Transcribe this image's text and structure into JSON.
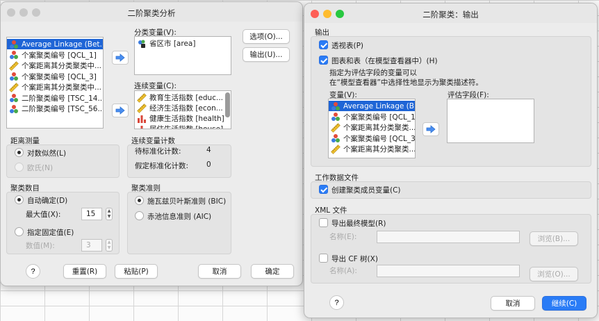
{
  "left_dialog": {
    "title": "二阶聚类分析",
    "variables": [
      {
        "label": "Average Linkage (Bet...",
        "icon": "cluster-icon",
        "selected": true
      },
      {
        "label": "个案聚类编号 [QCL_1]",
        "icon": "cluster-icon"
      },
      {
        "label": "个案距离其分类聚类中...",
        "icon": "ruler-icon"
      },
      {
        "label": "个案聚类编号 [QCL_3]",
        "icon": "cluster-icon"
      },
      {
        "label": "个案距离其分类聚类中...",
        "icon": "ruler-icon"
      },
      {
        "label": "二阶聚类编号 [TSC_14...",
        "icon": "cluster-icon"
      },
      {
        "label": "二阶聚类编号 [TSC_56...",
        "icon": "cluster-icon"
      }
    ],
    "categorical": {
      "label": "分类变量(V):",
      "items": [
        {
          "label": "省区市 [area]",
          "icon": "nominal-icon"
        }
      ]
    },
    "continuous": {
      "label": "连续变量(C):",
      "items": [
        {
          "label": "教育生活指数 [educ...",
          "icon": "ruler-icon"
        },
        {
          "label": "经济生活指数 [econ...",
          "icon": "ruler-icon"
        },
        {
          "label": "健康生活指数 [health]",
          "icon": "barchart-icon"
        },
        {
          "label": "居住生活指数 [house]",
          "icon": "barchart-icon"
        }
      ]
    },
    "buttons": {
      "options": "选项(O)...",
      "output": "输出(U)...",
      "reset": "重置(R)",
      "paste": "粘贴(P)",
      "cancel": "取消",
      "ok": "确定",
      "help": "?"
    },
    "distance": {
      "title": "距离测量",
      "loglik": "对数似然(L)",
      "euclid": "欧氏(N)"
    },
    "count": {
      "title": "连续变量计数",
      "standardized_label": "待标准化计数:",
      "standardized_value": "4",
      "assumed_label": "假定标准化计数:",
      "assumed_value": "0"
    },
    "clusters": {
      "title": "聚类数目",
      "auto": "自动确定(D)",
      "max_label": "最大值(X):",
      "max_value": "15",
      "fixed": "指定固定值(E)",
      "num_label": "数值(M):",
      "num_value": "3"
    },
    "criterion": {
      "title": "聚类准则",
      "bic": "施瓦兹贝叶斯准则 (BIC)",
      "aic": "赤池信息准则 (AIC)"
    }
  },
  "right_dialog": {
    "title": "二阶聚类：输出",
    "output_group": "输出",
    "pivot": "透视表(P)",
    "charts": "图表和表（在模型查看器中）(H)",
    "desc_line1": "指定为评估字段的变量可以",
    "desc_line2": "在“模型查看器”中选择性地显示为聚类描述符。",
    "vars_label": "变量(V):",
    "eval_label": "评估字段(F):",
    "variables": [
      {
        "label": "Average Linkage (B...",
        "icon": "cluster-icon",
        "selected": true
      },
      {
        "label": "个案聚类编号 [QCL_1]",
        "icon": "cluster-icon"
      },
      {
        "label": "个案距离其分类聚类...",
        "icon": "ruler-icon"
      },
      {
        "label": "个案聚类编号 [QCL_3]",
        "icon": "cluster-icon"
      },
      {
        "label": "个案距离其分类聚类...",
        "icon": "ruler-icon"
      }
    ],
    "workdata_group": "工作数据文件",
    "create_var": "创建聚类成员变量(C)",
    "xml_group": "XML 文件",
    "export_final": "导出最终模型(R)",
    "name_e": "名称(E):",
    "browse_b": "浏览(B)...",
    "export_cf": "导出 CF 树(X)",
    "name_a": "名称(A):",
    "browse_o": "浏览(O)...",
    "help": "?",
    "cancel": "取消",
    "continue": "继续(C)"
  },
  "colors": {
    "accent": "#2a7cf6",
    "selection": "#1f65d6",
    "traffic_red": "#fe5f57",
    "traffic_yellow": "#febc2e",
    "traffic_green": "#28c840",
    "traffic_inactive": "#c8c8c8"
  }
}
